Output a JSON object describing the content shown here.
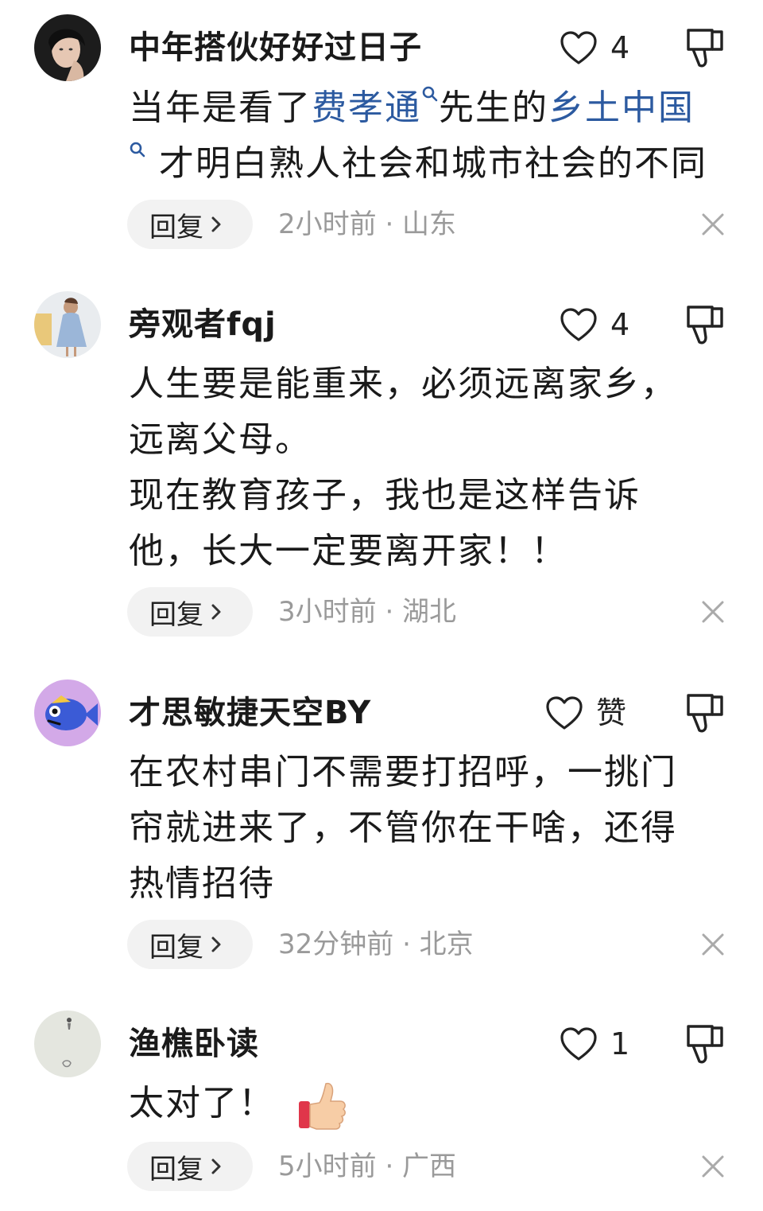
{
  "comments": [
    {
      "username": "中年搭伙好好过日子",
      "likes": "4",
      "content_parts": {
        "a": "当年是看了",
        "link1": "费孝通",
        "b": "先生的",
        "link2": "乡土中国",
        "c": "才明白熟人社会和城市社会的不同"
      },
      "reply_label": "回复",
      "meta": "2小时前 · 山东"
    },
    {
      "username": "旁观者fqj",
      "likes": "4",
      "lines": [
        "人生要是能重来，必须远离家乡，",
        "远离父母。",
        "现在教育孩子，我也是这样告诉",
        "他，长大一定要离开家！！"
      ],
      "reply_label": "回复",
      "meta": "3小时前 · 湖北"
    },
    {
      "username": "才思敏捷天空BY",
      "likes": "赞",
      "lines": [
        "在农村串门不需要打招呼，一挑门",
        "帘就进来了，不管你在干啥，还得",
        "热情招待"
      ],
      "reply_label": "回复",
      "meta": "32分钟前 · 北京"
    },
    {
      "username": "渔樵卧读",
      "likes": "1",
      "lines": [
        "太对了！"
      ],
      "emoji": "thumbs-up-emoji",
      "reply_label": "回复",
      "meta": "5小时前 · 广西"
    }
  ],
  "icons": {
    "like": "heart-outline-icon",
    "dislike": "thumbs-down-outline-icon",
    "search": "search-icon",
    "close": "close-icon",
    "chevron": "chevron-right-icon"
  },
  "colors": {
    "link": "#2c5aa0",
    "meta_text": "#9a9a9a",
    "reply_bg": "#f2f2f2",
    "text": "#1a1a1a"
  }
}
